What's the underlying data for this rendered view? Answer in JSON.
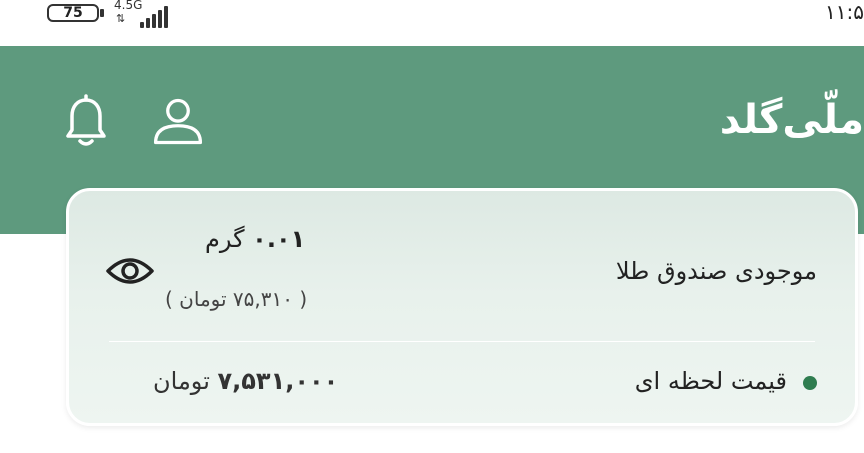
{
  "status_bar": {
    "battery": "75",
    "network": "4.5G",
    "time": "۱۱:۵"
  },
  "header": {
    "logo": "ملّی‌گلد",
    "icons": [
      "user-icon",
      "bell-icon"
    ],
    "background_color": "#5e9a7e"
  },
  "balance_card": {
    "label": "موجودی صندوق طلا",
    "gram_amount": "۰.۰۱",
    "gram_unit": "گرم",
    "toman_value": "( ۷۵,۳۱۰ تومان )",
    "live_price_label": "قیمت لحظه ای",
    "live_price_amount": "۷,۵۳۱,۰۰۰",
    "live_price_unit": "تومان",
    "live_dot_color": "#2f7d50"
  }
}
